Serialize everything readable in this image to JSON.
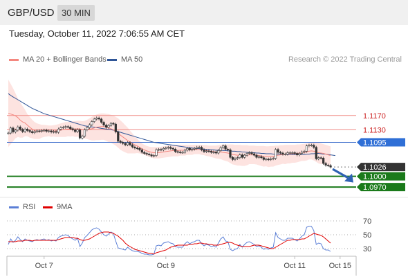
{
  "header": {
    "symbol": "GBP/USD",
    "timeframe": "30 MIN"
  },
  "datetime": "Tuesday, October 11, 2022 7:06:55 AM CET",
  "credit": "Research © 2022 Trading Central",
  "legend": {
    "ma20": {
      "label": "MA 20 + Bollinger Bands",
      "color": "#f4877f"
    },
    "ma50": {
      "label": "MA 50",
      "color": "#2f5597"
    },
    "rsi": {
      "label": "RSI",
      "color": "#5b7fd6"
    },
    "ma9": {
      "label": "9MA",
      "color": "#e00000"
    }
  },
  "chart_data": [
    {
      "type": "line",
      "title": "",
      "ylim": [
        1.0945,
        1.1305
      ],
      "x_labels": [
        {
          "label": "Oct 7",
          "index": 15
        },
        {
          "label": "Oct 9",
          "index": 66
        },
        {
          "label": "Oct 11",
          "index": 120
        },
        {
          "label": "Oct 15",
          "index": 139
        }
      ],
      "ohlc_close": [
        1.1121,
        1.1135,
        1.1124,
        1.1129,
        1.1138,
        1.1131,
        1.1125,
        1.1132,
        1.1128,
        1.1125,
        1.1122,
        1.1125,
        1.1127,
        1.1126,
        1.1128,
        1.1129,
        1.1126,
        1.1127,
        1.1124,
        1.1125,
        1.1123,
        1.1132,
        1.1136,
        1.1137,
        1.1139,
        1.1138,
        1.1133,
        1.113,
        1.1125,
        1.113,
        1.1107,
        1.1112,
        1.113,
        1.1136,
        1.1144,
        1.1153,
        1.116,
        1.1163,
        1.116,
        1.1151,
        1.1143,
        1.1137,
        1.1142,
        1.1148,
        1.1146,
        1.1124,
        1.1098,
        1.1095,
        1.1092,
        1.1088,
        1.1094,
        1.1088,
        1.1082,
        1.1079,
        1.1078,
        1.1074,
        1.1067,
        1.1064,
        1.1062,
        1.106,
        1.1057,
        1.1058,
        1.1074,
        1.1075,
        1.1074,
        1.1078,
        1.1079,
        1.1081,
        1.1078,
        1.1076,
        1.1069,
        1.1068,
        1.1067,
        1.1067,
        1.1073,
        1.1078,
        1.1074,
        1.1076,
        1.1078,
        1.1081,
        1.1081,
        1.1074,
        1.1069,
        1.1071,
        1.107,
        1.1067,
        1.1068,
        1.1065,
        1.1072,
        1.108,
        1.1085,
        1.1076,
        1.1074,
        1.1053,
        1.1047,
        1.105,
        1.1052,
        1.106,
        1.1053,
        1.1059,
        1.1064,
        1.1066,
        1.1063,
        1.1059,
        1.1053,
        1.1055,
        1.1052,
        1.1047,
        1.1048,
        1.1047,
        1.1049,
        1.105,
        1.1075,
        1.1067,
        1.1065,
        1.1062,
        1.1062,
        1.1066,
        1.1066,
        1.1066,
        1.1064,
        1.106,
        1.1064,
        1.1068,
        1.107,
        1.1085,
        1.1087,
        1.1087,
        1.1081,
        1.1049,
        1.1052,
        1.1051,
        1.1036,
        1.1031,
        1.103,
        1.1026
      ],
      "ma20": [
        1.1176,
        1.1174,
        1.1172,
        1.1169,
        1.1164,
        1.1157,
        1.1152,
        1.1149,
        1.1143,
        1.1137,
        1.1132,
        1.1128,
        1.1126,
        1.1125,
        1.1126,
        1.1127,
        1.1127,
        1.1127,
        1.1126,
        1.1127,
        1.1127,
        1.1128,
        1.1129,
        1.113,
        1.1131,
        1.1132,
        1.1132,
        1.1133,
        1.1132,
        1.1133,
        1.1132,
        1.113,
        1.113,
        1.1131,
        1.1132,
        1.1133,
        1.1135,
        1.1137,
        1.1138,
        1.1139,
        1.1139,
        1.1137,
        1.1135,
        1.1133,
        1.113,
        1.1126,
        1.1121,
        1.1115,
        1.111,
        1.1105,
        1.11,
        1.1096,
        1.1092,
        1.1088,
        1.1085,
        1.1081,
        1.1077,
        1.1074,
        1.1071,
        1.1069,
        1.1067,
        1.1066,
        1.1066,
        1.1066,
        1.1067,
        1.1068,
        1.1069,
        1.107,
        1.1071,
        1.1072,
        1.1072,
        1.1072,
        1.1073,
        1.1073,
        1.1073,
        1.1074,
        1.1074,
        1.1074,
        1.1075,
        1.1075,
        1.1075,
        1.1074,
        1.1073,
        1.1072,
        1.1071,
        1.107,
        1.1069,
        1.1068,
        1.1068,
        1.1068,
        1.1067,
        1.1066,
        1.1065,
        1.1063,
        1.1061,
        1.106,
        1.1059,
        1.1059,
        1.1058,
        1.1058,
        1.1059,
        1.106,
        1.106,
        1.106,
        1.1059,
        1.1058,
        1.1057,
        1.1056,
        1.1056,
        1.1055,
        1.1056,
        1.1056,
        1.1058,
        1.1059,
        1.106,
        1.1061,
        1.1061,
        1.1062,
        1.1062,
        1.1063,
        1.1063,
        1.1064,
        1.1065,
        1.1066,
        1.1067,
        1.1068,
        1.107,
        1.1071,
        1.107,
        1.1068,
        1.1066,
        1.1065,
        1.1064,
        1.1062,
        1.106,
        1.1058
      ],
      "bb_upper": [
        1.127,
        1.1258,
        1.1246,
        1.1232,
        1.1218,
        1.1206,
        1.1196,
        1.1186,
        1.1174,
        1.1166,
        1.1158,
        1.1152,
        1.1148,
        1.1146,
        1.1144,
        1.1144,
        1.1143,
        1.1142,
        1.1142,
        1.1143,
        1.1144,
        1.1146,
        1.1148,
        1.115,
        1.1152,
        1.1152,
        1.1153,
        1.1154,
        1.1154,
        1.1155,
        1.1155,
        1.1154,
        1.1155,
        1.1158,
        1.1162,
        1.1166,
        1.117,
        1.1173,
        1.1175,
        1.1176,
        1.1176,
        1.1175,
        1.1174,
        1.1172,
        1.117,
        1.1166,
        1.1162,
        1.1156,
        1.115,
        1.1143,
        1.1136,
        1.1128,
        1.112,
        1.1112,
        1.1105,
        1.1098,
        1.1092,
        1.1088,
        1.1085,
        1.1083,
        1.1082,
        1.1082,
        1.1082,
        1.1082,
        1.1083,
        1.1084,
        1.1085,
        1.1086,
        1.1087,
        1.1088,
        1.1088,
        1.1088,
        1.1088,
        1.1088,
        1.1088,
        1.1088,
        1.1088,
        1.1088,
        1.1088,
        1.1088,
        1.1088,
        1.1088,
        1.1087,
        1.1087,
        1.1086,
        1.1086,
        1.1086,
        1.1086,
        1.1087,
        1.1088,
        1.1089,
        1.1089,
        1.1089,
        1.1089,
        1.1089,
        1.1088,
        1.1088,
        1.1088,
        1.1087,
        1.1087,
        1.1087,
        1.1086,
        1.1086,
        1.1086,
        1.1085,
        1.1085,
        1.1085,
        1.1085,
        1.1084,
        1.1084,
        1.1085,
        1.1085,
        1.1086,
        1.1086,
        1.1087,
        1.1087,
        1.1088,
        1.1088,
        1.1088,
        1.1088,
        1.1088,
        1.1089,
        1.1089,
        1.109,
        1.1091,
        1.1092,
        1.1093,
        1.1095,
        1.1096,
        1.1096,
        1.1094,
        1.1092,
        1.109,
        1.1088,
        1.1086,
        1.1084
      ],
      "bb_lower": [
        1.1082,
        1.109,
        1.1098,
        1.1106,
        1.111,
        1.1108,
        1.1108,
        1.1112,
        1.1112,
        1.1108,
        1.1106,
        1.1104,
        1.1104,
        1.1104,
        1.1108,
        1.111,
        1.1111,
        1.1112,
        1.111,
        1.1111,
        1.111,
        1.111,
        1.111,
        1.111,
        1.111,
        1.1112,
        1.1111,
        1.1112,
        1.111,
        1.1111,
        1.1109,
        1.1106,
        1.1105,
        1.1104,
        1.1102,
        1.11,
        1.11,
        1.1101,
        1.1101,
        1.1102,
        1.1102,
        1.1099,
        1.1096,
        1.1094,
        1.109,
        1.1086,
        1.108,
        1.1074,
        1.107,
        1.1067,
        1.1064,
        1.1064,
        1.1064,
        1.1064,
        1.1065,
        1.1064,
        1.1062,
        1.106,
        1.1057,
        1.1055,
        1.1052,
        1.105,
        1.105,
        1.105,
        1.1051,
        1.1052,
        1.1053,
        1.1054,
        1.1055,
        1.1056,
        1.1056,
        1.1056,
        1.1058,
        1.1058,
        1.1058,
        1.106,
        1.106,
        1.106,
        1.1062,
        1.1062,
        1.1062,
        1.106,
        1.1059,
        1.1057,
        1.1056,
        1.1054,
        1.1052,
        1.105,
        1.1049,
        1.1048,
        1.1045,
        1.1043,
        1.1041,
        1.1037,
        1.1033,
        1.1032,
        1.103,
        1.103,
        1.1029,
        1.1029,
        1.1031,
        1.1034,
        1.1034,
        1.1034,
        1.1033,
        1.1031,
        1.1029,
        1.1027,
        1.1028,
        1.1026,
        1.1027,
        1.1027,
        1.103,
        1.1032,
        1.1033,
        1.1035,
        1.1034,
        1.1036,
        1.1036,
        1.1038,
        1.1038,
        1.1039,
        1.1041,
        1.1043,
        1.1043,
        1.1044,
        1.1047,
        1.1047,
        1.1044,
        1.104,
        1.1036,
        1.1034,
        1.1034,
        1.1032,
        1.103,
        1.1028
      ],
      "ma50": [
        1.1231,
        1.1226,
        1.1222,
        1.1218,
        1.1214,
        1.121,
        1.1206,
        1.1202,
        1.1198,
        1.1194,
        1.119,
        1.1187,
        1.1184,
        1.1181,
        1.1178,
        1.1175,
        1.1173,
        1.1171,
        1.1169,
        1.1167,
        1.1165,
        1.1163,
        1.1161,
        1.1159,
        1.1157,
        1.1155,
        1.1153,
        1.1151,
        1.1149,
        1.1147,
        1.1145,
        1.1143,
        1.1141,
        1.114,
        1.1139,
        1.1138,
        1.1137,
        1.1136,
        1.1135,
        1.1134,
        1.1133,
        1.1132,
        1.1131,
        1.113,
        1.1129,
        1.1127,
        1.1125,
        1.1123,
        1.1121,
        1.1119,
        1.1117,
        1.1115,
        1.1113,
        1.1111,
        1.1109,
        1.1107,
        1.1105,
        1.1103,
        1.1101,
        1.1099,
        1.1097,
        1.1095,
        1.1094,
        1.1093,
        1.1092,
        1.1091,
        1.109,
        1.1089,
        1.1088,
        1.1087,
        1.1086,
        1.1085,
        1.1084,
        1.1083,
        1.1082,
        1.1081,
        1.108,
        1.1079,
        1.1078,
        1.1078,
        1.1077,
        1.1076,
        1.1076,
        1.1075,
        1.1075,
        1.1074,
        1.1074,
        1.1073,
        1.1073,
        1.1073,
        1.1072,
        1.1072,
        1.1071,
        1.1071,
        1.107,
        1.107,
        1.1069,
        1.1069,
        1.1068,
        1.1068,
        1.1067,
        1.1067,
        1.1066,
        1.1066,
        1.1065,
        1.1065,
        1.1064,
        1.1064,
        1.1063,
        1.1063,
        1.1063,
        1.1062,
        1.1062,
        1.1062,
        1.1062,
        1.1062,
        1.1061,
        1.1061,
        1.1061,
        1.1061,
        1.1061,
        1.1061,
        1.1061,
        1.1061,
        1.1061,
        1.1062,
        1.1062,
        1.1063,
        1.1063,
        1.1064,
        1.1064,
        1.1063,
        1.1062,
        1.1062,
        1.1061,
        1.106,
        1.1059,
        1.1058
      ],
      "levels": [
        {
          "value": 1.117,
          "label": "1.1170",
          "kind": "resistance"
        },
        {
          "value": 1.113,
          "label": "1.1130",
          "kind": "resistance"
        },
        {
          "value": 1.1095,
          "label": "1.1095",
          "kind": "pivot"
        },
        {
          "value": 1.1026,
          "label": "1.1026",
          "kind": "last"
        },
        {
          "value": 1.1,
          "label": "1.1000",
          "kind": "support"
        },
        {
          "value": 1.097,
          "label": "1.0970",
          "kind": "support"
        }
      ]
    },
    {
      "type": "line",
      "title": "",
      "ylim": [
        20,
        80
      ],
      "yticks": [
        70,
        50,
        30
      ],
      "rsi": [
        36,
        44,
        39,
        42,
        47,
        43,
        40,
        44,
        42,
        41,
        40,
        42,
        43,
        42,
        43,
        44,
        42,
        43,
        41,
        42,
        41,
        46,
        48,
        49,
        50,
        49,
        46,
        44,
        42,
        45,
        33,
        38,
        46,
        49,
        53,
        57,
        59,
        60,
        58,
        54,
        50,
        48,
        51,
        54,
        52,
        41,
        31,
        30,
        29,
        28,
        32,
        29,
        27,
        26,
        26,
        25,
        23,
        22,
        22,
        21,
        21,
        22,
        34,
        35,
        34,
        38,
        39,
        40,
        38,
        37,
        33,
        32,
        32,
        32,
        37,
        40,
        37,
        39,
        40,
        42,
        42,
        37,
        34,
        36,
        35,
        33,
        34,
        32,
        38,
        44,
        47,
        41,
        40,
        29,
        27,
        29,
        30,
        36,
        32,
        36,
        39,
        40,
        38,
        36,
        33,
        34,
        32,
        29,
        30,
        29,
        31,
        32,
        53,
        46,
        44,
        42,
        42,
        45,
        45,
        45,
        43,
        41,
        44,
        48,
        50,
        61,
        62,
        62,
        56,
        36,
        38,
        37,
        30,
        28,
        28,
        26
      ],
      "ma9": [
        40,
        40,
        40,
        40,
        41,
        41,
        41,
        42,
        42,
        42,
        41,
        42,
        42,
        42,
        42,
        42,
        42,
        42,
        42,
        42,
        42,
        43,
        44,
        45,
        46,
        46,
        46,
        46,
        45,
        45,
        43,
        42,
        42,
        43,
        44,
        46,
        48,
        50,
        52,
        53,
        54,
        54,
        54,
        53,
        52,
        50,
        48,
        45,
        42,
        38,
        35,
        33,
        31,
        29,
        28,
        27,
        26,
        25,
        24,
        23,
        23,
        22,
        24,
        25,
        26,
        27,
        28,
        30,
        32,
        33,
        34,
        35,
        35,
        35,
        35,
        35,
        36,
        36,
        37,
        37,
        38,
        38,
        37,
        37,
        36,
        36,
        35,
        35,
        35,
        36,
        37,
        38,
        39,
        39,
        38,
        36,
        35,
        34,
        33,
        33,
        33,
        33,
        34,
        35,
        35,
        35,
        34,
        33,
        32,
        31,
        30,
        30,
        32,
        34,
        36,
        38,
        40,
        42,
        42,
        43,
        43,
        43,
        43,
        44,
        44,
        46,
        48,
        50,
        52,
        51,
        50,
        49,
        47,
        44,
        41,
        38
      ]
    }
  ]
}
